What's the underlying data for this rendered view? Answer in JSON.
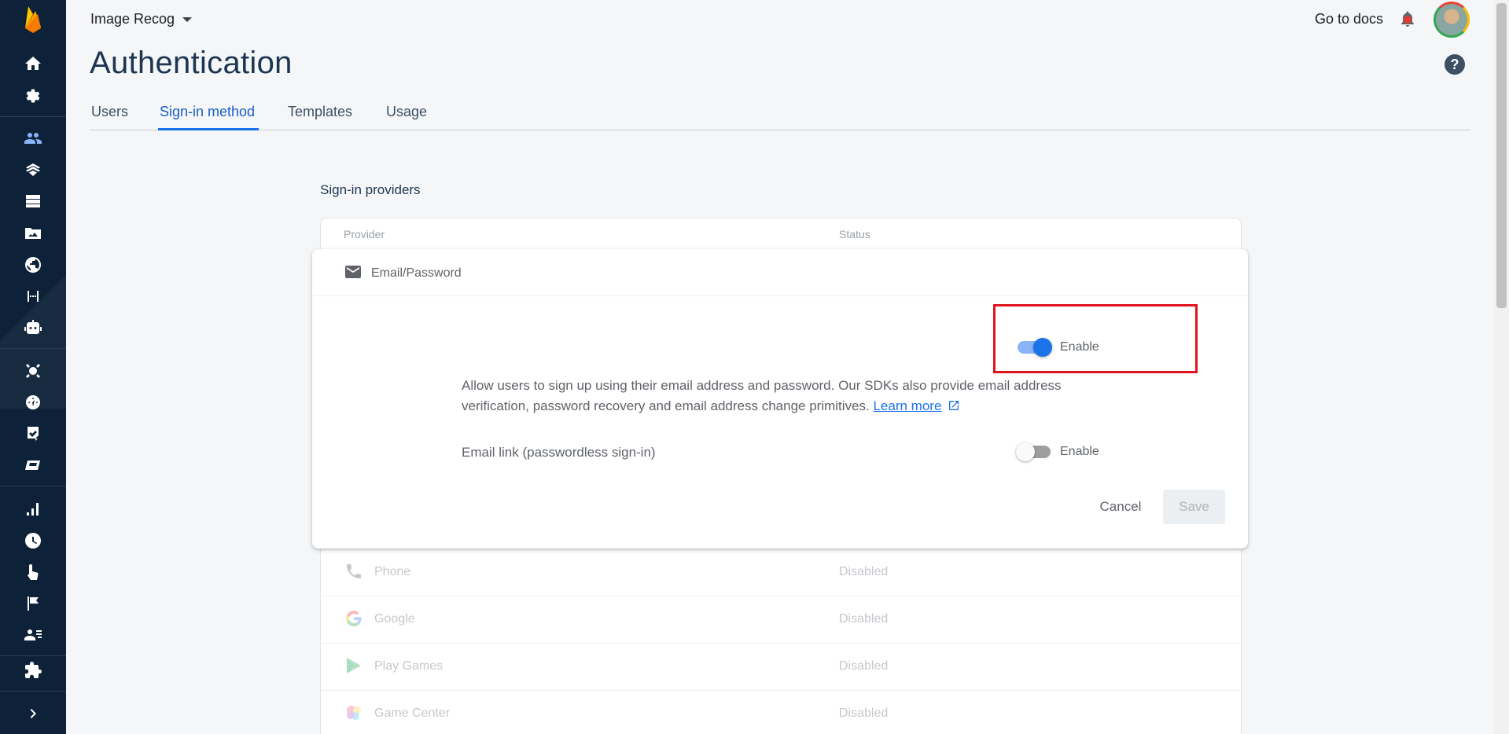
{
  "header": {
    "project_name": "Image Recog",
    "docs_link": "Go to docs"
  },
  "page": {
    "title": "Authentication"
  },
  "tabs": [
    {
      "label": "Users"
    },
    {
      "label": "Sign-in method",
      "active": true
    },
    {
      "label": "Templates"
    },
    {
      "label": "Usage"
    }
  ],
  "providers": {
    "section_title": "Sign-in providers",
    "columns": {
      "provider": "Provider",
      "status": "Status"
    },
    "rows": [
      {
        "name": "Phone",
        "status": "Disabled",
        "icon": "phone-icon"
      },
      {
        "name": "Google",
        "status": "Disabled",
        "icon": "google-icon"
      },
      {
        "name": "Play Games",
        "status": "Disabled",
        "icon": "play-games-icon"
      },
      {
        "name": "Game Center",
        "status": "Disabled",
        "icon": "game-center-icon"
      }
    ]
  },
  "dialog": {
    "provider_title": "Email/Password",
    "enable_label": "Enable",
    "enabled": true,
    "description": "Allow users to sign up using their email address and password. Our SDKs also provide email address verification, password recovery and email address change primitives.",
    "learn_more": "Learn more",
    "email_link_label": "Email link (passwordless sign-in)",
    "email_link_enable_label": "Enable",
    "email_link_enabled": false,
    "cancel_label": "Cancel",
    "save_label": "Save"
  },
  "colors": {
    "sidebar_bg": "#0d2238",
    "accent": "#1a73e8",
    "highlight": "#e0141e"
  }
}
